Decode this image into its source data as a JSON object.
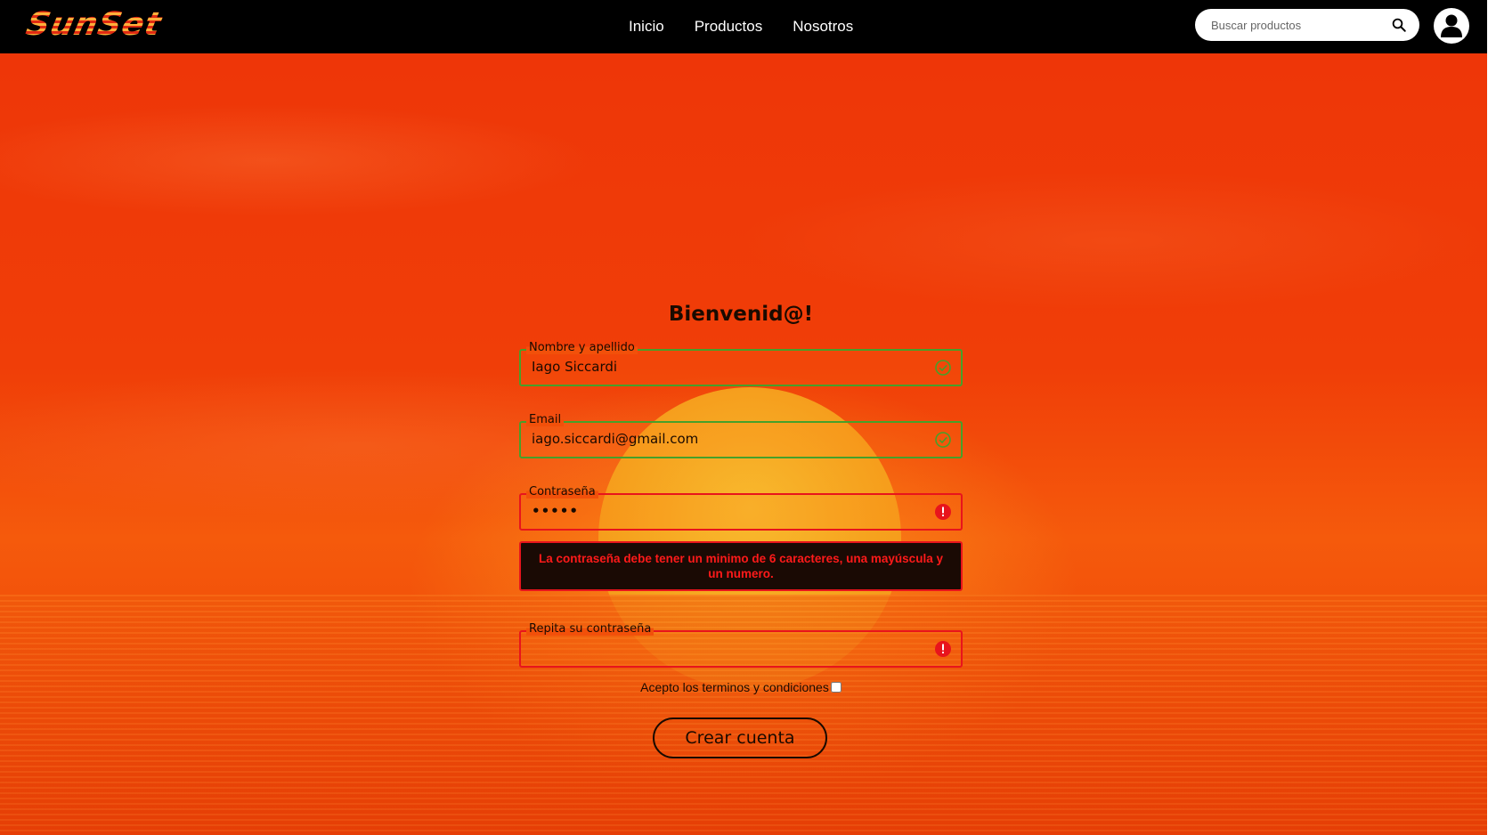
{
  "header": {
    "logo_text": "SunSet",
    "nav": [
      "Inicio",
      "Productos",
      "Nosotros"
    ],
    "search_placeholder": "Buscar productos"
  },
  "form": {
    "title": "Bienvenid@!",
    "fields": [
      {
        "label": "Nombre y apellido",
        "value": "Iago Siccardi",
        "status": "valid"
      },
      {
        "label": "Email",
        "value": "iago.siccardi@gmail.com",
        "status": "valid"
      },
      {
        "label": "Contraseña",
        "value": "•••••",
        "status": "invalid"
      },
      {
        "label": "Repita su contraseña",
        "value": "",
        "status": "invalid"
      }
    ],
    "error_message": "La contraseña debe tener un minimo de 6 caracteres, una mayúscula y un numero.",
    "terms_label": "Acepto los terminos y condiciones",
    "terms_checked": false,
    "submit_label": "Crear cuenta"
  },
  "colors": {
    "valid": "#46a02a",
    "invalid": "#e8141c",
    "background_orange": "#f04a08",
    "navbar": "#000000"
  }
}
